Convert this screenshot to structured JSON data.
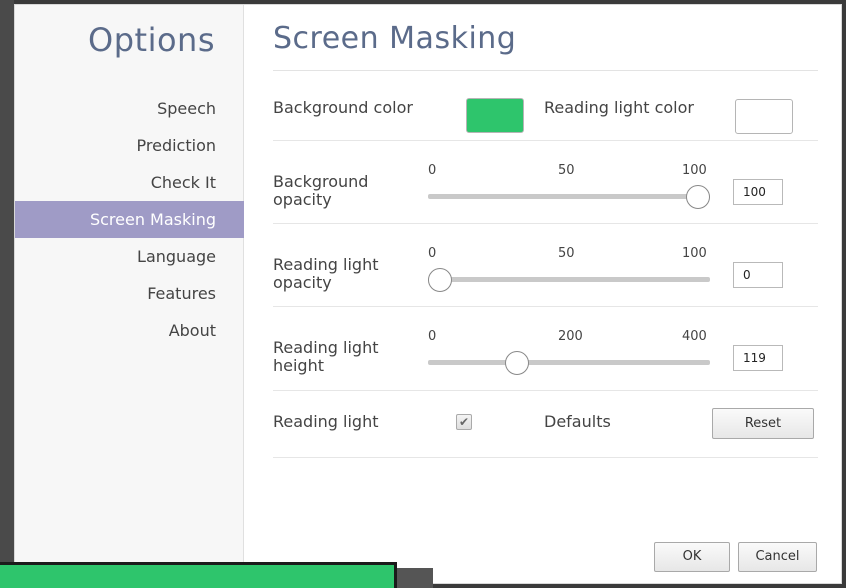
{
  "sidebar": {
    "title": "Options",
    "items": [
      {
        "label": "Speech",
        "active": false
      },
      {
        "label": "Prediction",
        "active": false
      },
      {
        "label": "Check It",
        "active": false
      },
      {
        "label": "Screen Masking",
        "active": true
      },
      {
        "label": "Language",
        "active": false
      },
      {
        "label": "Features",
        "active": false
      },
      {
        "label": "About",
        "active": false
      }
    ]
  },
  "main": {
    "title": "Screen Masking",
    "background_color": {
      "label": "Background color",
      "value": "#2ec56c"
    },
    "reading_light_color": {
      "label": "Reading light color",
      "value": "#ffffff"
    },
    "background_opacity": {
      "label_line1": "Background",
      "label_line2": "opacity",
      "ticks": [
        "0",
        "50",
        "100"
      ],
      "min": 0,
      "max": 100,
      "value": "100"
    },
    "reading_light_opacity": {
      "label_line1": "Reading light",
      "label_line2": "opacity",
      "ticks": [
        "0",
        "50",
        "100"
      ],
      "min": 0,
      "max": 100,
      "value": "0"
    },
    "reading_light_height": {
      "label_line1": "Reading light",
      "label_line2": "height",
      "ticks": [
        "0",
        "200",
        "400"
      ],
      "min": 0,
      "max": 400,
      "value": "119"
    },
    "reading_light": {
      "label": "Reading light",
      "checked": true,
      "check_glyph": "✔"
    },
    "defaults": {
      "label": "Defaults",
      "reset_label": "Reset"
    }
  },
  "footer": {
    "ok_label": "OK",
    "cancel_label": "Cancel"
  },
  "colors": {
    "accent": "#9f9bc6",
    "title": "#5b6b8a",
    "mask_green": "#2ec56c"
  }
}
